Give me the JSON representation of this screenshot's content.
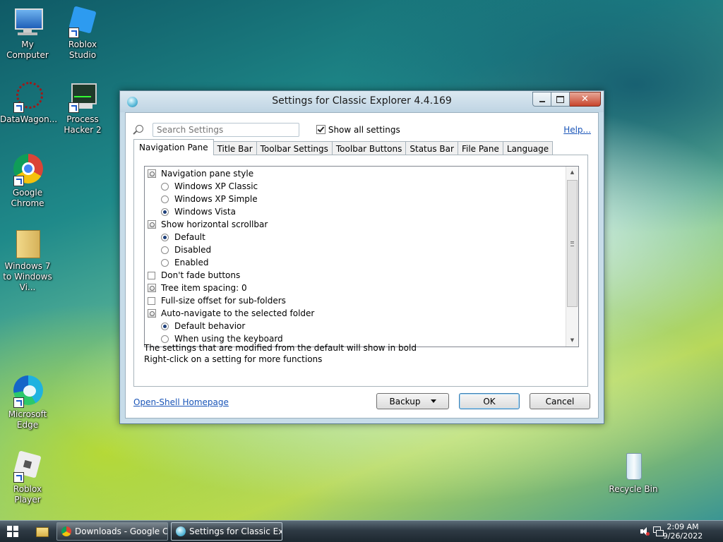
{
  "desktop": {
    "icons": [
      {
        "label": "My Computer"
      },
      {
        "label": "Roblox Studio"
      },
      {
        "label": "DataWagon..."
      },
      {
        "label": "Process Hacker 2"
      },
      {
        "label": "Google Chrome"
      },
      {
        "label": "Windows 7 to Windows Vi..."
      },
      {
        "label": "Microsoft Edge"
      },
      {
        "label": "Roblox Player"
      },
      {
        "label": "Recycle Bin"
      }
    ]
  },
  "window": {
    "title": "Settings for Classic Explorer 4.4.169",
    "close_glyph": "✕",
    "search_placeholder": "Search Settings",
    "show_all_label": "Show all settings",
    "show_all_checked": true,
    "help_label": "Help...",
    "tabs": [
      {
        "label": "Navigation Pane",
        "active": true
      },
      {
        "label": "Title Bar"
      },
      {
        "label": "Toolbar Settings"
      },
      {
        "label": "Toolbar Buttons"
      },
      {
        "label": "Status Bar"
      },
      {
        "label": "File Pane"
      },
      {
        "label": "Language"
      }
    ],
    "settings": [
      {
        "type": "group",
        "label": "Navigation pane style"
      },
      {
        "type": "radio",
        "label": "Windows XP Classic",
        "checked": false
      },
      {
        "type": "radio",
        "label": "Windows XP Simple",
        "checked": false
      },
      {
        "type": "radio",
        "label": "Windows Vista",
        "checked": true
      },
      {
        "type": "group",
        "label": "Show horizontal scrollbar"
      },
      {
        "type": "radio",
        "label": "Default",
        "checked": true
      },
      {
        "type": "radio",
        "label": "Disabled",
        "checked": false
      },
      {
        "type": "radio",
        "label": "Enabled",
        "checked": false
      },
      {
        "type": "check",
        "label": "Don't fade buttons",
        "checked": false
      },
      {
        "type": "group",
        "label": "Tree item spacing: 0"
      },
      {
        "type": "check",
        "label": "Full-size offset for sub-folders",
        "checked": false
      },
      {
        "type": "group",
        "label": "Auto-navigate to the selected folder"
      },
      {
        "type": "radio",
        "label": "Default behavior",
        "checked": true
      },
      {
        "type": "radio",
        "label": "When using the keyboard",
        "checked": false
      }
    ],
    "note_line1": "The settings that are modified from the default will show in bold",
    "note_line2": "Right-click on a setting for more functions",
    "homepage_link": "Open-Shell Homepage",
    "backup_label": "Backup",
    "ok_label": "OK",
    "cancel_label": "Cancel"
  },
  "taskbar": {
    "buttons": [
      {
        "label": "Downloads - Google Chr...",
        "icon": "chrome-icon"
      },
      {
        "label": "Settings for Classic Expl...",
        "icon": "classic-explorer-icon",
        "active": true
      }
    ],
    "time": "2:09 AM",
    "date": "9/26/2022"
  }
}
